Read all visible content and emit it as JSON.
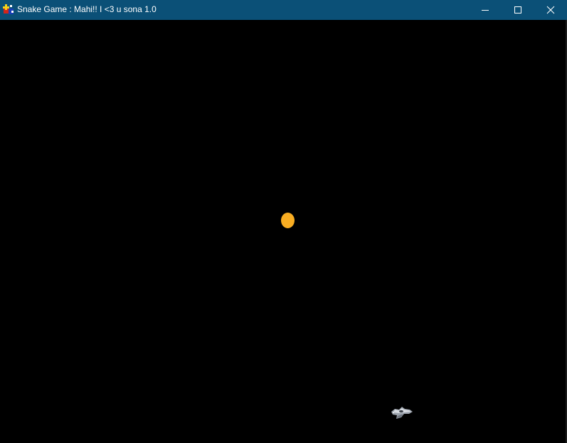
{
  "window": {
    "title": "Snake Game : Mahi!! I <3 u sona 1.0",
    "titlebar_color": "#0b5077",
    "controls": [
      "minimize-icon",
      "maximize-icon",
      "close-icon"
    ]
  },
  "game": {
    "background_color": "#000000",
    "food": {
      "shape": "circle",
      "color": "#f9ad22"
    },
    "player": {
      "icon": "spaceship-icon",
      "color": "#b9bec6"
    }
  }
}
